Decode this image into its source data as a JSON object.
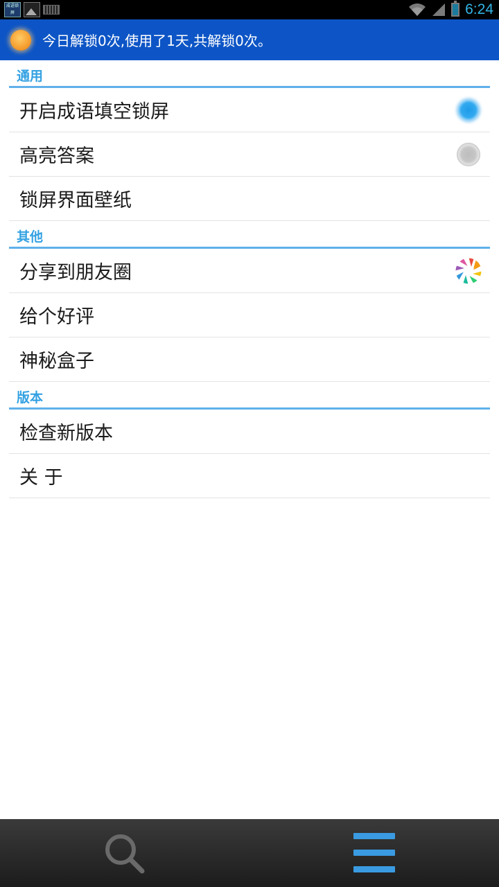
{
  "status_bar": {
    "app_icon_text": "成语锁屏",
    "time": "6:24",
    "accent_color": "#33b5e5"
  },
  "header": {
    "icon": "sun-icon",
    "message": "今日解锁0次,使用了1天,共解锁0次。",
    "background": "#0d55c6"
  },
  "sections": [
    {
      "title": "通用",
      "items": [
        {
          "label": "开启成语填空锁屏",
          "control": "radio-on"
        },
        {
          "label": "高亮答案",
          "control": "radio-off"
        },
        {
          "label": "锁屏界面壁纸",
          "control": "none"
        }
      ]
    },
    {
      "title": "其他",
      "items": [
        {
          "label": "分享到朋友圈",
          "control": "moments-icon"
        },
        {
          "label": "给个好评",
          "control": "none"
        },
        {
          "label": "神秘盒子",
          "control": "none"
        }
      ]
    },
    {
      "title": "版本",
      "items": [
        {
          "label": "检查新版本",
          "control": "none"
        },
        {
          "label": "关 于",
          "control": "none"
        }
      ]
    }
  ],
  "bottom_bar": {
    "left_icon": "search-icon",
    "right_icon": "menu-icon",
    "menu_color": "#3a9be2"
  }
}
